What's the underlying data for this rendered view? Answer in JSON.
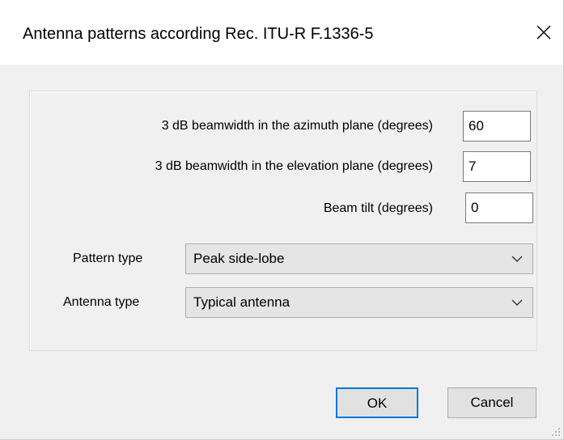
{
  "dialog": {
    "title": "Antenna patterns according Rec. ITU-R F.1336-5",
    "close_icon": "close-icon"
  },
  "fields": {
    "azimuth": {
      "label": "3 dB beamwidth in the azimuth plane (degrees)",
      "value": "60"
    },
    "elevation": {
      "label": "3 dB beamwidth in the elevation plane (degrees)",
      "value": "7"
    },
    "tilt": {
      "label": "Beam tilt (degrees)",
      "value": "0"
    }
  },
  "selects": {
    "pattern_type": {
      "label": "Pattern type",
      "value": "Peak side-lobe",
      "icon": "chevron-down-icon"
    },
    "antenna_type": {
      "label": "Antenna type",
      "value": "Typical antenna",
      "icon": "chevron-down-icon"
    }
  },
  "buttons": {
    "ok": "OK",
    "cancel": "Cancel"
  },
  "colors": {
    "focus_border": "#0078d7",
    "window_bg": "#f0f0f0",
    "titlebar_bg": "#ffffff"
  }
}
